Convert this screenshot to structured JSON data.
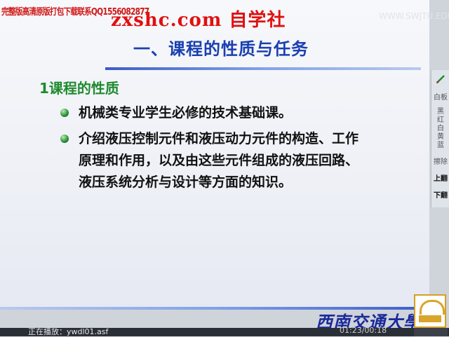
{
  "watermark": {
    "left_text": "完整版高清原版打包下载联系QQ1556082877",
    "site_text": "zxshc.com 自学社",
    "corner_text": "WWW.SWJTU.EDU"
  },
  "slide": {
    "title": "一、课程的性质与任务",
    "subhead": "1课程的性质",
    "bullets": [
      "机械类专业学生必修的技术基础课。",
      "介绍液压控制元件和液压动力元件的构造、工作原理和作用，以及由这些元件组成的液压回路、液压系统分析与设计等方面的知识。"
    ],
    "logo_text": "西南交通大學"
  },
  "side_panel": {
    "items": [
      "白板",
      "黑",
      "红",
      "白",
      "黄",
      "蓝",
      "擦除",
      "上翻",
      "下翻"
    ]
  },
  "status_bar": {
    "playing_label": "正在播放：ywdl01.asf",
    "time": "01:23/00:18"
  },
  "colors": {
    "title": "#1a3fb0",
    "subhead": "#1e8a2e",
    "watermark": "#e01010",
    "bullet": "#2a8a3a",
    "logo": "#1a2a9a"
  }
}
